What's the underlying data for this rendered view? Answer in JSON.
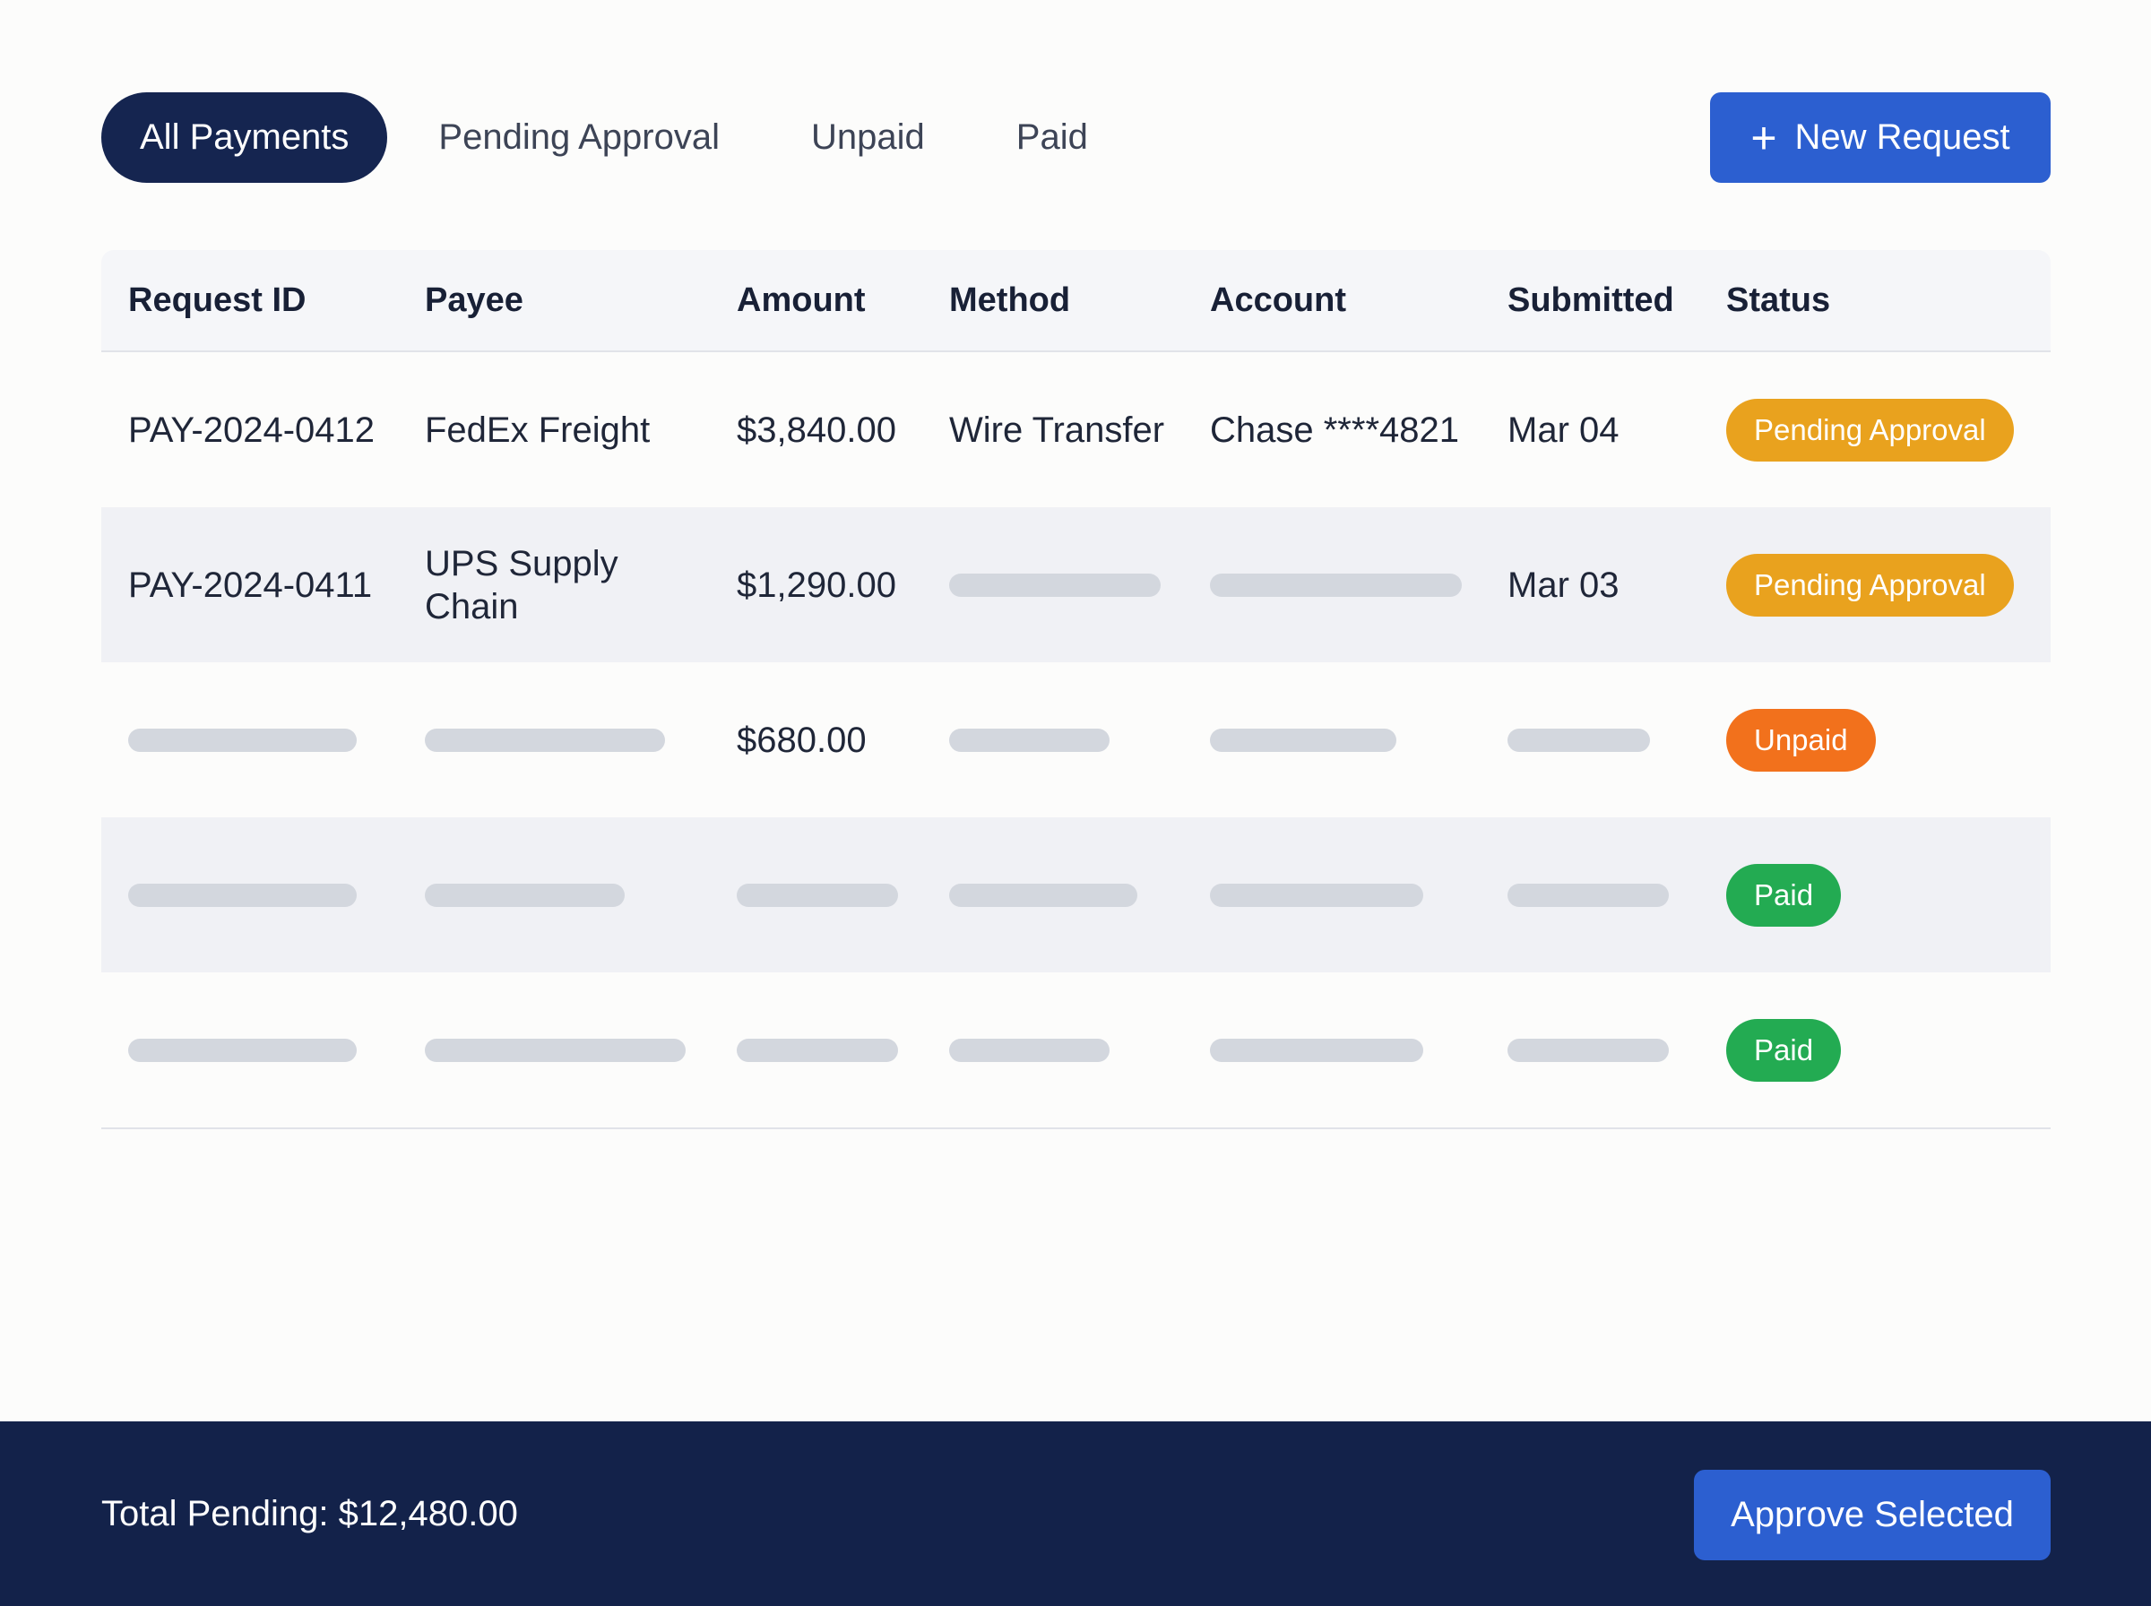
{
  "tabs": [
    {
      "label": "All Payments",
      "active": true
    },
    {
      "label": "Pending Approval",
      "active": false
    },
    {
      "label": "Unpaid",
      "active": false
    },
    {
      "label": "Paid",
      "active": false
    }
  ],
  "new_request": {
    "label": "New Request",
    "icon": "plus-icon"
  },
  "table": {
    "columns": [
      "Request ID",
      "Payee",
      "Amount",
      "Method",
      "Account",
      "Submitted",
      "Status"
    ],
    "rows": [
      {
        "id": "PAY-2024-0412",
        "payee": [
          "FedEx Freight"
        ],
        "amount": "$3,840.00",
        "method": "Wire Transfer",
        "account": "Chase ****4821",
        "submitted": "Mar 04",
        "status": "Pending Approval",
        "status_color": "#e9a21e"
      },
      {
        "id": "PAY-2024-0411",
        "payee": [
          "UPS Supply",
          "Chain"
        ],
        "amount": "$1,290.00",
        "method": null,
        "account": null,
        "submitted": "Mar 03",
        "status": "Pending Approval",
        "status_color": "#e9a21e"
      },
      {
        "id": null,
        "payee": null,
        "amount": "$680.00",
        "method": null,
        "account": null,
        "submitted": null,
        "status": "Unpaid",
        "status_color": "#f2711c"
      },
      {
        "id": null,
        "payee": null,
        "amount": null,
        "method": null,
        "account": null,
        "submitted": null,
        "status": "Paid",
        "status_color": "#23ab52"
      },
      {
        "id": null,
        "payee": null,
        "amount": null,
        "method": null,
        "account": null,
        "submitted": null,
        "status": "Paid",
        "status_color": "#23ab52"
      }
    ]
  },
  "footer": {
    "total_label": "Total Pending: $12,480.00",
    "approve_label": "Approve Selected"
  },
  "colors": {
    "navy": "#152550",
    "accent": "#2c5fd0",
    "skeleton": "#d3d7de"
  }
}
